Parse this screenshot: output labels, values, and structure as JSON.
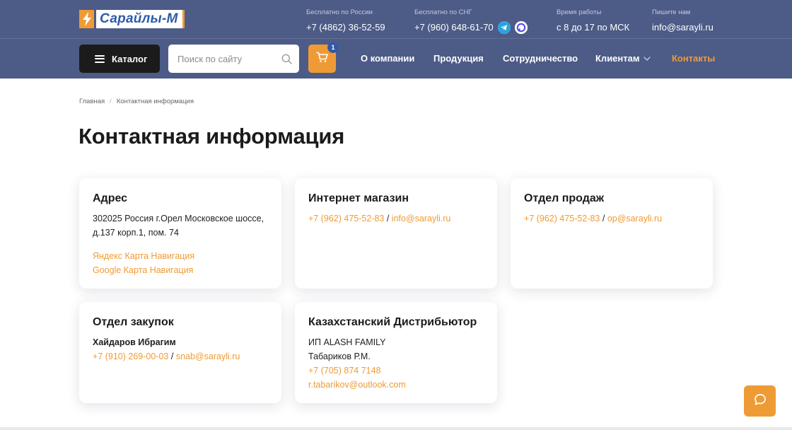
{
  "brand": {
    "name": "Сарайлы-М",
    "accent": "#ef9b35",
    "header_bg": "#4d5b87",
    "link_color": "#ef9b35"
  },
  "topbar": {
    "phone_russia": {
      "label": "Бесплатно по России",
      "value": "+7 (4862) 36-52-59"
    },
    "phone_cis": {
      "label": "Бесплатно по СНГ",
      "value": "+7 (960) 648-61-70",
      "icons": [
        "telegram-icon",
        "messenger-icon"
      ]
    },
    "hours": {
      "label": "Время работы",
      "value": "с 8 до 17 по МСК"
    },
    "email": {
      "label": "Пишите нам",
      "value": "info@sarayli.ru"
    }
  },
  "nav": {
    "catalog_label": "Каталог",
    "search_placeholder": "Поиск по сайту",
    "cart_count": "1",
    "items": [
      "О компании",
      "Продукция",
      "Сотрудничество",
      "Клиентам",
      "Контакты"
    ],
    "active_item": "Контакты"
  },
  "breadcrumb": {
    "home": "Главная",
    "separator": "/",
    "current": "Контактная информация"
  },
  "page_title": "Контактная информация",
  "cards": {
    "address": {
      "title": "Адрес",
      "line1": "302025 Россия г.Орел Московское шоссе,",
      "line2": "д.137 корп.1, пом. 74",
      "link1": "Яндекс Карта Навигация",
      "link2": "Google Карта Навигация"
    },
    "shop": {
      "title": "Интернет магазин",
      "phone": "+7 (962) 475-52-83",
      "separator": "/",
      "email": "info@sarayli.ru"
    },
    "sales": {
      "title": "Отдел продаж",
      "phone": "+7 (962) 475-52-83",
      "separator": "/",
      "email": "op@sarayli.ru"
    },
    "procurement": {
      "title": "Отдел закупок",
      "person": "Хайдаров Ибрагим",
      "phone": "+7 (910) 269-00-03",
      "separator": "/",
      "email": "snab@sarayli.ru"
    },
    "kazakhstan": {
      "title": "Казахстанский Дистрибьютор",
      "company": "ИП ALASH FAMILY",
      "person": "Табариков Р.М.",
      "phone": "+7 (705) 874 7148",
      "email": "r.tabarikov@outlook.com"
    }
  }
}
